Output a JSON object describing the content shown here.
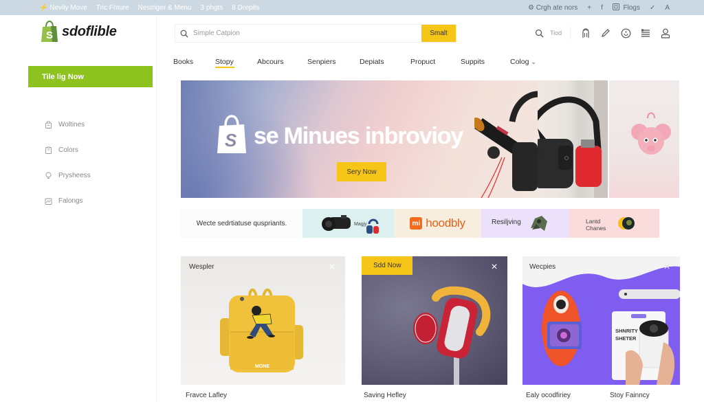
{
  "topbar": {
    "left_items": [
      {
        "icon": "bolt-icon",
        "label": "Nevily Move"
      },
      {
        "label": "Tric Fhture"
      },
      {
        "label": "Nestriger & Menu"
      },
      {
        "label": "3 phgts"
      },
      {
        "label": "8 Drepits"
      }
    ],
    "right_items": {
      "settings_label": "Crgh ate nors",
      "plus_glyph": "+",
      "facebook_glyph": "f",
      "flags_label": "Flogs",
      "chevron_glyph": "✓",
      "font_glyph": "A"
    }
  },
  "brand": {
    "name": "sdoflible",
    "logo_letter": "S",
    "accent": "#8dc21f"
  },
  "search": {
    "placeholder": "Simple Catpion",
    "button_label": "Smalt",
    "button_color": "#f5c518"
  },
  "header_icons": {
    "search_label": "Tiod",
    "icons": [
      "search-icon",
      "glove-icon",
      "pencil-icon",
      "clock-icon",
      "list-icon",
      "user-icon"
    ]
  },
  "nav": {
    "items": [
      {
        "label": "Books",
        "active": false
      },
      {
        "label": "Stopy",
        "active": true
      },
      {
        "label": "Abcours",
        "active": false
      },
      {
        "label": "Senpiers",
        "active": false
      },
      {
        "label": "Depiats",
        "active": false
      },
      {
        "label": "Propuct",
        "active": false
      },
      {
        "label": "Suppits",
        "active": false
      },
      {
        "label": "Colog",
        "active": false,
        "dropdown": true
      }
    ],
    "dropdown_glyph": "⌄"
  },
  "sidebar": {
    "cta_label": "Tile lig Now",
    "items": [
      {
        "icon": "bag-icon",
        "label": "Woltines"
      },
      {
        "icon": "clipboard-icon",
        "label": "Colors"
      },
      {
        "icon": "bulb-icon",
        "label": "Prysheess"
      },
      {
        "icon": "chart-icon",
        "label": "Falongs"
      }
    ]
  },
  "hero": {
    "title": "se Minues inbrovioy",
    "logo_letter": "S",
    "button_label": "Sery Now"
  },
  "promos": [
    {
      "text": "Wecte sedrtiatuse quspriants."
    },
    {
      "text": "Magjy"
    },
    {
      "brand_mark": "mi",
      "text": "hoodbly"
    },
    {
      "text": "Resiljving"
    },
    {
      "text_line1": "Lantd",
      "text_line2": "Chanes"
    }
  ],
  "cards": [
    {
      "title": "Wespler",
      "close_glyph": "×",
      "image": "yellow backpack"
    },
    {
      "badge": "Sdd Now",
      "close_glyph": "×",
      "image": "red headphones"
    },
    {
      "title": "Wecpies",
      "close_glyph": "×",
      "image": "camera robot",
      "label_line1": "SHNRITY",
      "label_line2": "SHETER"
    }
  ],
  "captions": [
    "Fravce Lafley",
    "Saving Hefley",
    "Ealy ocodfiriey",
    "Stoy Fainncy"
  ]
}
